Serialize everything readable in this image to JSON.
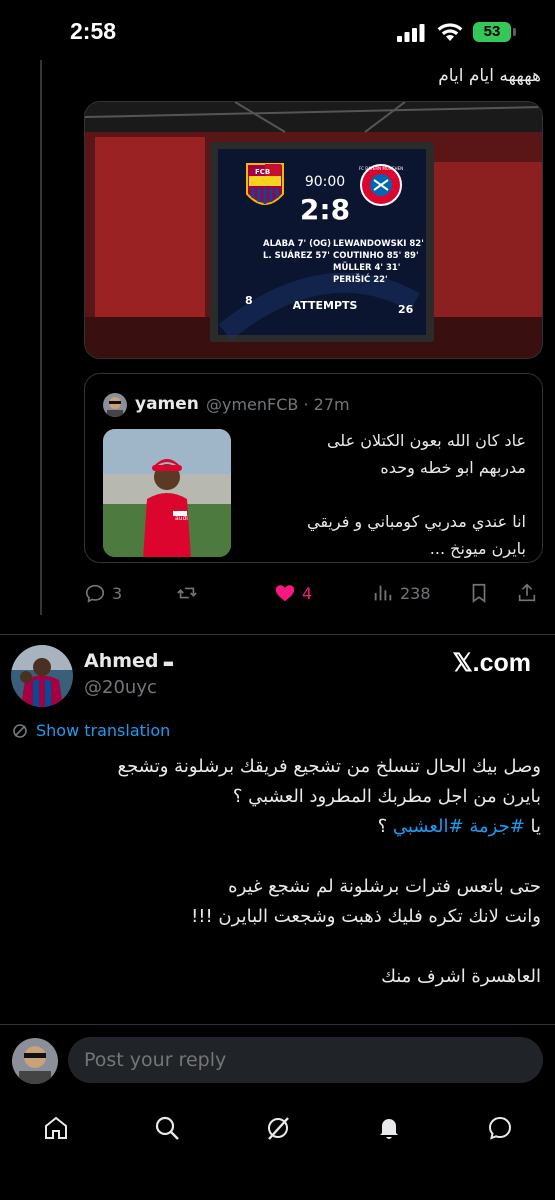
{
  "status_bar": {
    "time": "2:58",
    "battery": "53"
  },
  "reply": {
    "text": "ههههه ايام ايام"
  },
  "scoreboard": {
    "home_logo_text": "FCB",
    "away_logo_text": "FC BAYERN MÜNCHEN",
    "time": "90:00",
    "score": "2:8",
    "home_scorers": [
      "ALABA 7' (OG)",
      "L. SUÁREZ 57'"
    ],
    "away_scorers": [
      "LEWANDOWSKI 82'",
      "COUTINHO 85' 89'",
      "MÜLLER 4' 31'",
      "PERIŠIĆ 22'"
    ],
    "home_attempts": "8",
    "attempts_label": "ATTEMPTS",
    "away_attempts": "26"
  },
  "quote": {
    "name": "yamen",
    "handle": "@ymenFCB · 27m",
    "text": "عاد كان الله بعون الكتلان على\nمدربهم ابو خطه وحده\n\nانا عندي مدربي كومباني و فريقي\nبايرن ميونخ ...",
    "thumb_logo": "audi"
  },
  "actions": {
    "replies": "3",
    "likes": "4",
    "views": "238"
  },
  "tweet": {
    "name": "Ahmed",
    "handle": "@20uyc",
    "brand": "𝕏.com",
    "show_translation": "Show translation",
    "lines": [
      "وصل بيك الحال تنسلخ من تشجيع فريقك برشلونة وتشجع",
      "بايرن من اجل مطربك المطرود العشبي ؟",
      "",
      "",
      "حتى باتعس فترات برشلونة لم نشجع غيره",
      "وانت لانك تكره فليك ذهبت وشجعت البايرن !!!",
      "",
      "العاهسرة اشرف منك"
    ],
    "hashtag_prefix": "يا ",
    "hashtags": "#جزمة #العشبي",
    "hashtag_suffix": " ؟"
  },
  "reply_bar": {
    "placeholder": "Post your reply"
  },
  "colors": {
    "accent": "#1d9bf0",
    "like": "#f91880",
    "battery": "#34c759"
  },
  "tab_bar": {
    "icons": [
      "home-icon",
      "search-icon",
      "grok-icon",
      "notifications-icon",
      "messages-icon"
    ]
  }
}
